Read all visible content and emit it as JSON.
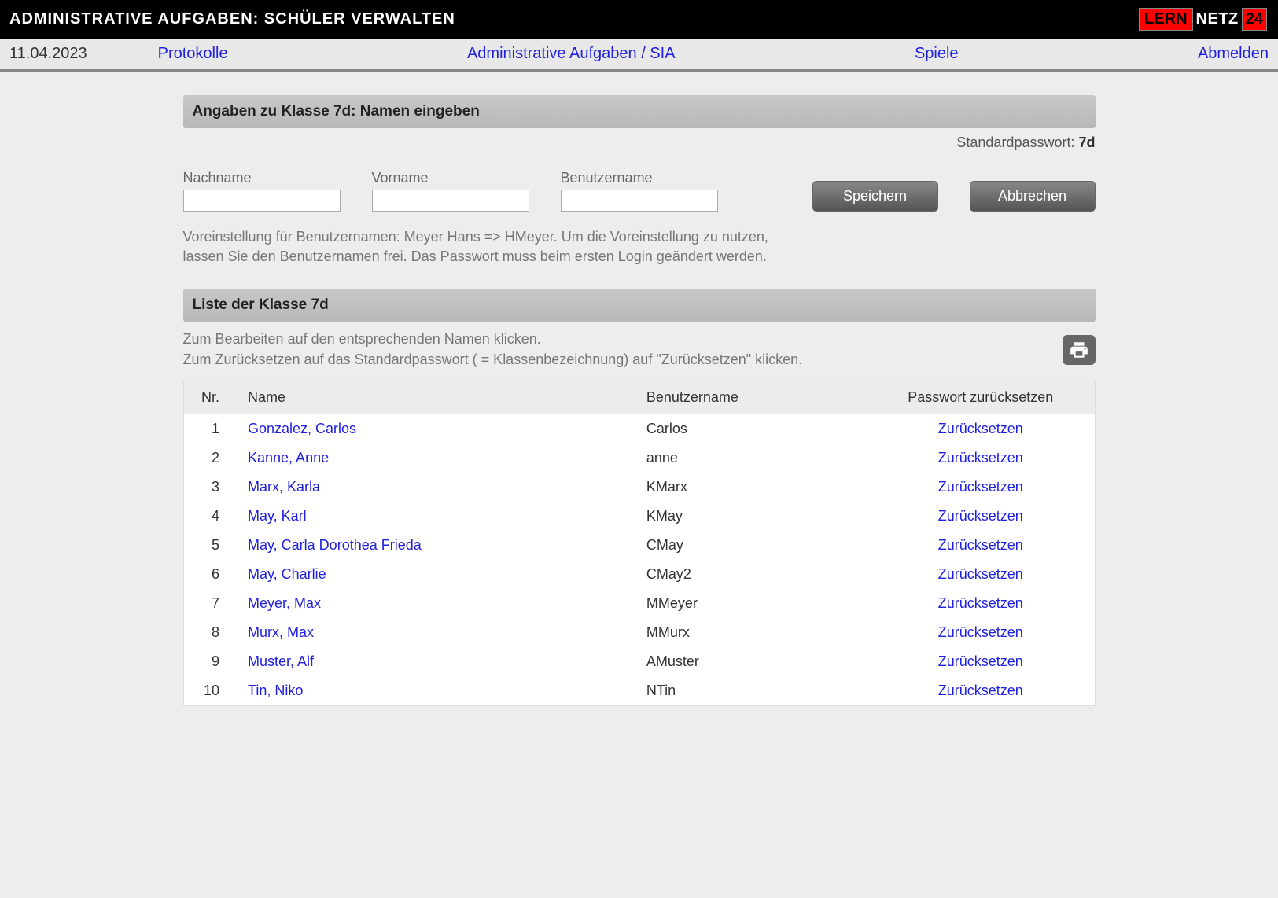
{
  "header": {
    "title": "ADMINISTRATIVE AUFGABEN: SCHÜLER VERWALTEN",
    "logo": {
      "lern": "LERN",
      "netz": "NETZ",
      "tf": "24"
    }
  },
  "nav": {
    "date": "11.04.2023",
    "protokolle": "Protokolle",
    "admin_sia": "Administrative Aufgaben / SIA",
    "spiele": "Spiele",
    "abmelden": "Abmelden"
  },
  "section1": {
    "title": "Angaben zu Klasse 7d: Namen eingeben",
    "password_label": "Standardpasswort: ",
    "password_value": "7d",
    "fields": {
      "nachname_label": "Nachname",
      "vorname_label": "Vorname",
      "benutzername_label": "Benutzername"
    },
    "buttons": {
      "save": "Speichern",
      "cancel": "Abbrechen"
    },
    "hint_line1": "Voreinstellung für Benutzernamen: Meyer Hans => HMeyer. Um die Voreinstellung zu nutzen,",
    "hint_line2": "lassen Sie den Benutzernamen frei. Das Passwort muss beim ersten Login geändert werden."
  },
  "section2": {
    "title": "Liste der Klasse 7d",
    "instr_line1": "Zum Bearbeiten auf den entsprechenden Namen klicken.",
    "instr_line2": "Zum Zurücksetzen auf das Standardpasswort ( = Klassenbezeichnung) auf \"Zurücksetzen\" klicken.",
    "columns": {
      "nr": "Nr.",
      "name": "Name",
      "user": "Benutzername",
      "reset": "Passwort zurücksetzen"
    },
    "reset_label": "Zurücksetzen",
    "students": [
      {
        "nr": "1",
        "name": "Gonzalez, Carlos",
        "user": "Carlos"
      },
      {
        "nr": "2",
        "name": "Kanne, Anne",
        "user": "anne"
      },
      {
        "nr": "3",
        "name": "Marx, Karla",
        "user": "KMarx"
      },
      {
        "nr": "4",
        "name": "May, Karl",
        "user": "KMay"
      },
      {
        "nr": "5",
        "name": "May, Carla Dorothea Frieda",
        "user": "CMay"
      },
      {
        "nr": "6",
        "name": "May, Charlie",
        "user": "CMay2"
      },
      {
        "nr": "7",
        "name": "Meyer, Max",
        "user": "MMeyer"
      },
      {
        "nr": "8",
        "name": "Murx, Max",
        "user": "MMurx"
      },
      {
        "nr": "9",
        "name": "Muster, Alf",
        "user": "AMuster"
      },
      {
        "nr": "10",
        "name": "Tin, Niko",
        "user": "NTin"
      }
    ]
  }
}
